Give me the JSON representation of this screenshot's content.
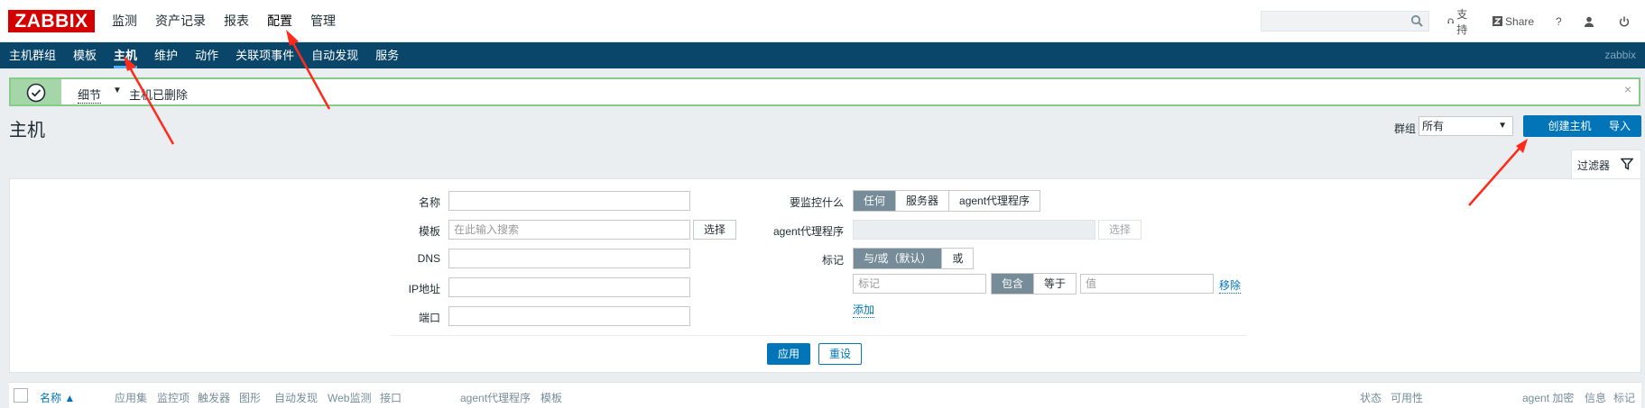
{
  "topbar": {
    "logo": "ZABBIX",
    "nav": [
      "监测",
      "资产记录",
      "报表",
      "配置",
      "管理"
    ],
    "active_nav": "配置",
    "search": {
      "value": "",
      "placeholder": ""
    },
    "support": "支持",
    "share": "Share",
    "help": "?"
  },
  "subnav": {
    "items": [
      "主机群组",
      "模板",
      "主机",
      "维护",
      "动作",
      "关联项事件",
      "自动发现",
      "服务"
    ],
    "active": "主机",
    "brand": "zabbix"
  },
  "message": {
    "details_label": "细节",
    "text": "主机已删除",
    "close": "×"
  },
  "page": {
    "title": "主机",
    "group_label": "群组",
    "group_value": "所有",
    "create_label": "创建主机",
    "import_label": "导入"
  },
  "filter": {
    "tab_label": "过滤器",
    "name_label": "名称",
    "template_label": "模板",
    "template_placeholder": "在此输入搜索",
    "select_label": "选择",
    "dns_label": "DNS",
    "ip_label": "IP地址",
    "port_label": "端口",
    "monitored_by_label": "要监控什么",
    "monitored_by_options": [
      "任何",
      "服务器",
      "agent代理程序"
    ],
    "monitored_by_selected": "任何",
    "proxy_label": "agent代理程序",
    "proxy_select_label": "选择",
    "tags_label": "标记",
    "tags_mode_options": [
      "与/或（默认）",
      "或"
    ],
    "tags_mode_selected": "与/或（默认）",
    "tag_placeholder": "标记",
    "tag_op_options": [
      "包含",
      "等于"
    ],
    "tag_op_selected": "包含",
    "value_placeholder": "值",
    "remove_label": "移除",
    "add_label": "添加",
    "apply_label": "应用",
    "reset_label": "重设"
  },
  "table": {
    "columns": [
      "名称 ▲",
      "应用集",
      "监控项",
      "触发器",
      "图形",
      "自动发现",
      "Web监测",
      "接口",
      "agent代理程序",
      "模板",
      "状态",
      "可用性",
      "agent 加密",
      "信息",
      "标记"
    ]
  },
  "colors": {
    "brand_red": "#d40000",
    "subnav_blue": "#0a466a",
    "primary_button": "#0275b8",
    "success_green": "#86cc89",
    "annotation_red": "#ff2a1a"
  }
}
